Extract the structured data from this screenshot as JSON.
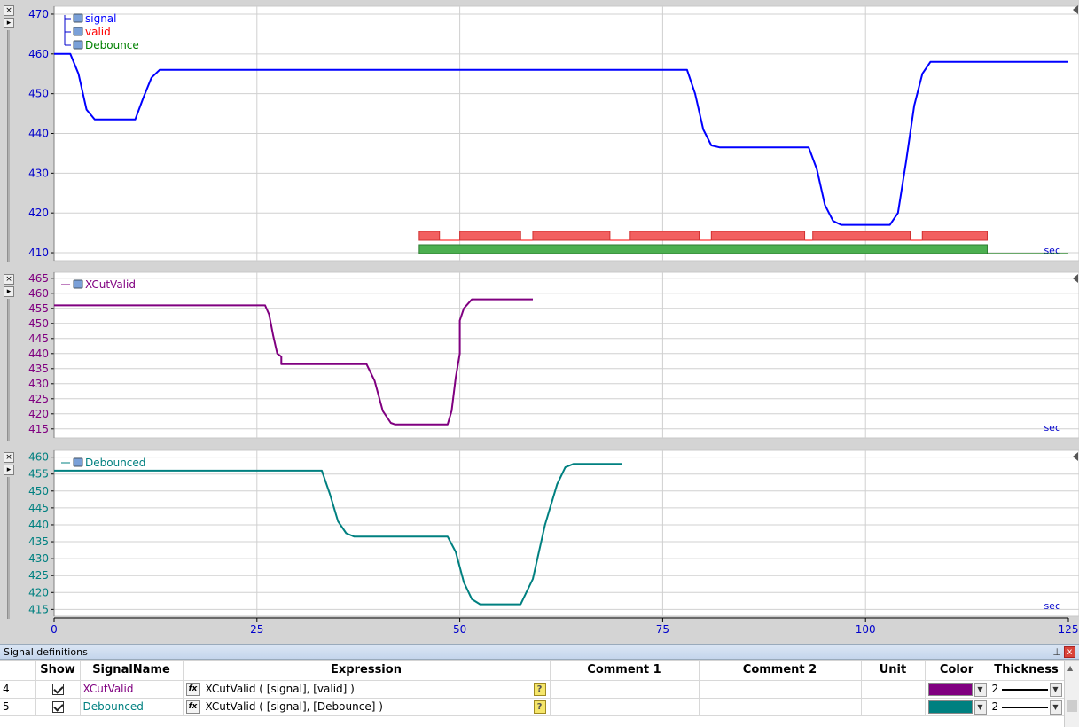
{
  "panes": [
    {
      "legend": [
        {
          "name": "signal",
          "color": "#0000ff"
        },
        {
          "name": "valid",
          "color": "#ff0000"
        },
        {
          "name": "Debounce",
          "color": "#008000"
        }
      ],
      "ticks": [
        "470",
        "460",
        "450",
        "440",
        "430",
        "420",
        "410"
      ],
      "unit": "sec"
    },
    {
      "legend": [
        {
          "name": "XCutValid",
          "color": "#800080"
        }
      ],
      "ticks": [
        "465",
        "460",
        "455",
        "450",
        "445",
        "440",
        "435",
        "430",
        "425",
        "420",
        "415"
      ],
      "unit": "sec"
    },
    {
      "legend": [
        {
          "name": "Debounced",
          "color": "#008080"
        }
      ],
      "ticks": [
        "460",
        "455",
        "450",
        "445",
        "440",
        "435",
        "430",
        "425",
        "420",
        "415"
      ],
      "unit": "sec"
    }
  ],
  "x_axis": {
    "ticks": [
      "0",
      "25",
      "50",
      "75",
      "100",
      "125"
    ],
    "color": "#0000cc"
  },
  "chart_data": [
    {
      "type": "line",
      "x_range": [
        0,
        125
      ],
      "ylim": [
        408,
        472
      ],
      "series": [
        {
          "name": "signal",
          "color": "#0000ff",
          "points": [
            [
              0,
              460
            ],
            [
              2,
              460
            ],
            [
              3,
              455
            ],
            [
              4,
              446
            ],
            [
              5,
              443.5
            ],
            [
              10,
              443.5
            ],
            [
              11,
              449
            ],
            [
              12,
              454
            ],
            [
              13,
              456
            ],
            [
              78,
              456
            ],
            [
              79,
              450
            ],
            [
              80,
              441
            ],
            [
              81,
              437
            ],
            [
              82,
              436.5
            ],
            [
              93,
              436.5
            ],
            [
              94,
              431
            ],
            [
              95,
              422
            ],
            [
              96,
              418
            ],
            [
              97,
              417
            ],
            [
              103,
              417
            ],
            [
              104,
              420
            ],
            [
              105,
              433
            ],
            [
              106,
              447
            ],
            [
              107,
              455
            ],
            [
              108,
              458
            ],
            [
              125,
              458
            ]
          ]
        },
        {
          "name": "valid",
          "color": "#ff0000",
          "segments": [
            [
              45,
              47.5
            ],
            [
              50,
              57.5
            ],
            [
              59,
              68.5
            ],
            [
              71,
              79.5
            ],
            [
              81,
              92.5
            ],
            [
              93.5,
              105.5
            ],
            [
              107,
              115
            ]
          ]
        },
        {
          "name": "Debounce",
          "color": "#008000",
          "segments": [
            [
              45,
              115
            ]
          ]
        }
      ]
    },
    {
      "type": "line",
      "x_range": [
        0,
        125
      ],
      "ylim": [
        412,
        467
      ],
      "series": [
        {
          "name": "XCutValid",
          "color": "#800080",
          "points": [
            [
              0,
              456
            ],
            [
              26,
              456
            ],
            [
              26.5,
              453
            ],
            [
              27,
              446
            ],
            [
              27.5,
              440
            ],
            [
              28,
              439
            ],
            [
              28,
              436.5
            ],
            [
              38.5,
              436.5
            ],
            [
              39.5,
              431
            ],
            [
              40.5,
              421
            ],
            [
              41.5,
              417
            ],
            [
              42,
              416.5
            ],
            [
              48.5,
              416.5
            ],
            [
              49,
              421
            ],
            [
              49.5,
              432
            ],
            [
              50,
              440
            ],
            [
              50,
              451
            ],
            [
              50.5,
              455
            ],
            [
              51.5,
              458
            ],
            [
              59,
              458
            ]
          ]
        }
      ]
    },
    {
      "type": "line",
      "x_range": [
        0,
        125
      ],
      "ylim": [
        413,
        462
      ],
      "series": [
        {
          "name": "Debounced",
          "color": "#008080",
          "points": [
            [
              0,
              456
            ],
            [
              33,
              456
            ],
            [
              34,
              449
            ],
            [
              35,
              441
            ],
            [
              36,
              437.5
            ],
            [
              37,
              436.5
            ],
            [
              48.5,
              436.5
            ],
            [
              49.5,
              432
            ],
            [
              50.5,
              423
            ],
            [
              51.5,
              418
            ],
            [
              52.5,
              416.5
            ],
            [
              57.5,
              416.5
            ],
            [
              59,
              424
            ],
            [
              60.5,
              440
            ],
            [
              62,
              452
            ],
            [
              63,
              457
            ],
            [
              64,
              458
            ],
            [
              70,
              458
            ]
          ]
        }
      ]
    }
  ],
  "signal_definitions": {
    "title": "Signal definitions",
    "pin_icon": "pin-icon",
    "close_label": "x",
    "columns": [
      "",
      "Show",
      "SignalName",
      "Expression",
      "Comment 1",
      "Comment 2",
      "Unit",
      "Color",
      "Thickness"
    ],
    "rows": [
      {
        "index": "4",
        "show": true,
        "name": "XCutValid",
        "name_color": "#800080",
        "expression": "XCutValid ( [signal], [valid] )",
        "comment1": "",
        "comment2": "",
        "unit": "",
        "color": "#800080",
        "thickness": "2"
      },
      {
        "index": "5",
        "show": true,
        "name": "Debounced",
        "name_color": "#008080",
        "expression": "XCutValid ( [signal], [Debounce] )",
        "comment1": "",
        "comment2": "",
        "unit": "",
        "color": "#008080",
        "thickness": "2"
      }
    ]
  }
}
